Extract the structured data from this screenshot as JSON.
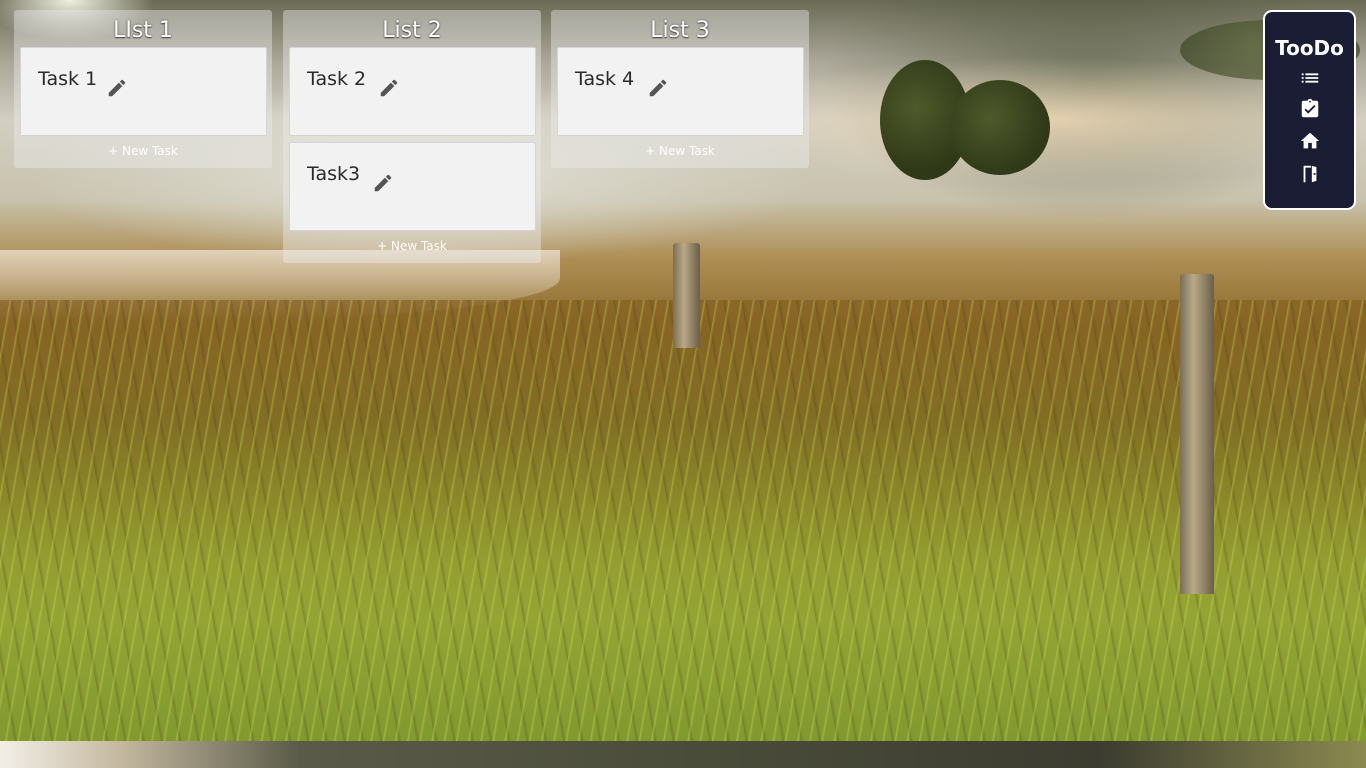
{
  "lists": [
    {
      "title": "LIst 1",
      "tasks": [
        "Task 1"
      ],
      "new_task_label": "+ New Task"
    },
    {
      "title": "List 2",
      "tasks": [
        "Task 2",
        "Task3"
      ],
      "new_task_label": "+ New Task"
    },
    {
      "title": "List 3",
      "tasks": [
        "Task 4"
      ],
      "new_task_label": "+ New Task"
    }
  ],
  "nav": {
    "app_title": "TooDo",
    "items": [
      {
        "icon": "list-icon"
      },
      {
        "icon": "clipboard-check-icon"
      },
      {
        "icon": "home-icon"
      },
      {
        "icon": "exit-door-icon"
      }
    ]
  },
  "colors": {
    "nav_background": "#1a1d33",
    "card_background": "#f2f2f2",
    "list_background": "rgba(235,235,235,0.42)",
    "edit_icon": "#555555"
  }
}
